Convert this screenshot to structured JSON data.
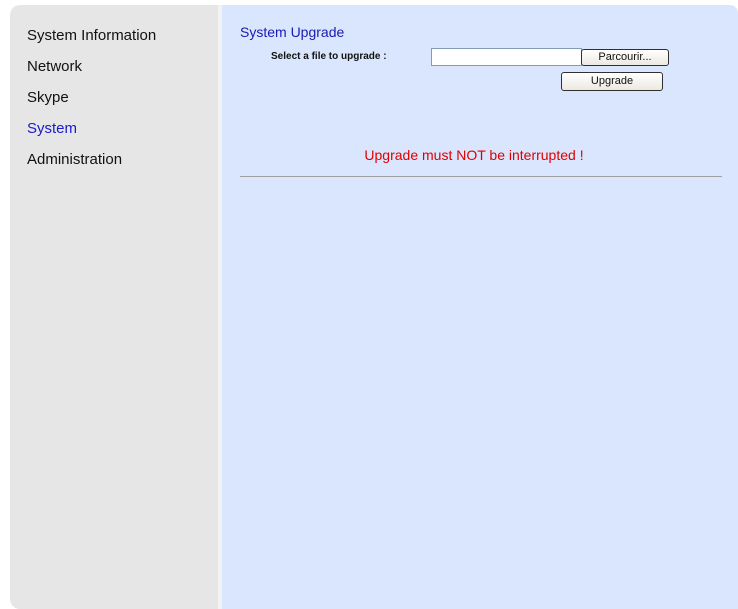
{
  "sidebar": {
    "items": [
      {
        "label": "System Information",
        "active": false
      },
      {
        "label": "Network",
        "active": false
      },
      {
        "label": "Skype",
        "active": false
      },
      {
        "label": "System",
        "active": true
      },
      {
        "label": "Administration",
        "active": false
      }
    ]
  },
  "main": {
    "title": "System Upgrade",
    "file_label": "Select a file to upgrade :",
    "file_value": "",
    "browse_label": "Parcourir...",
    "upgrade_label": "Upgrade",
    "warning": "Upgrade must NOT be interrupted !"
  },
  "colors": {
    "sidebar_bg": "#e6e6e6",
    "content_bg": "#d9e6fd",
    "active_nav": "#1a1acc",
    "title": "#1a1ab4",
    "warning": "#e00000"
  }
}
